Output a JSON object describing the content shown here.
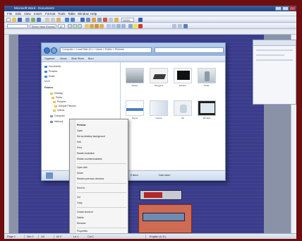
{
  "app": {
    "title": "Microsoft Word - Document1"
  },
  "menu": [
    "File",
    "Edit",
    "View",
    "Insert",
    "Format",
    "Tools",
    "Table",
    "Window",
    "Help"
  ],
  "toolbar": {
    "font": "Times New Roman",
    "size": "12",
    "zoom": "100%"
  },
  "explorer": {
    "address": "Computer > Local Disk (C:) > Users > Public > Pictures",
    "toolbar_items": [
      "Organize",
      "Views",
      "Slide Show",
      "Burn"
    ],
    "favorites": [
      "Documents",
      "Pictures",
      "Music",
      "More"
    ],
    "folders_header": "Folders",
    "folders": [
      "Desktop",
      "Public",
      "Pictures",
      "Sample Pictures",
      "Videos",
      "Computer",
      "Network"
    ],
    "thumbnails": [
      "Desert",
      "Penguins",
      "Monitor",
      "Photo",
      "Scene",
      "Layout",
      "Jar",
      "Window"
    ],
    "status_left": "8 items",
    "status_right": "Date taken"
  },
  "context_menu": [
    "Preview",
    "Open",
    "Set as desktop background",
    "Edit",
    "Print",
    "Rotate clockwise",
    "Rotate counterclockwise",
    "Open with",
    "Share",
    "Restore previous versions",
    "Send to",
    "Cut",
    "Copy",
    "Create shortcut",
    "Delete",
    "Rename",
    "Properties"
  ],
  "statusbar": [
    "Page 1",
    "Sec 1",
    "1/2",
    "At 1\"",
    "Ln 1",
    "Col 1",
    "English (U.S.)"
  ]
}
